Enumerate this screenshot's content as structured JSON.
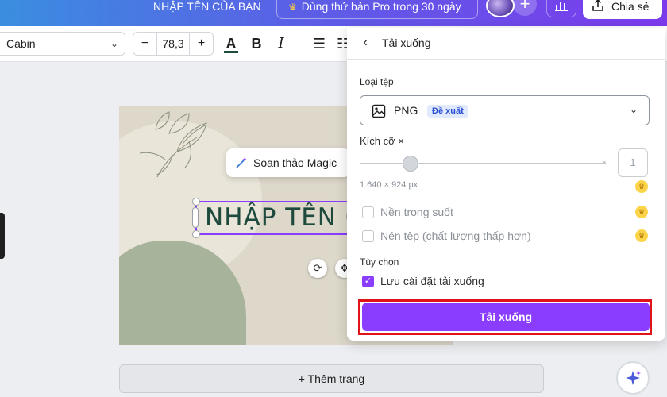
{
  "header": {
    "doc_title": "NHẬP TÊN CỦA BẠN",
    "pro_trial": "Dùng thử bản Pro trong 30 ngày",
    "add_label": "+",
    "share_label": "Chia sẻ"
  },
  "toolbar": {
    "font_family": "Cabin",
    "font_size": "78,3",
    "minus": "−",
    "plus": "+",
    "text_color_glyph": "A",
    "bold_glyph": "B",
    "italic_glyph": "I",
    "align_glyph": "☰",
    "list_glyph": "☷"
  },
  "canvas": {
    "heading": "NHẬP TÊN CỦA BẠN",
    "magic_edit": "Soạn thảo Magic",
    "add_page": "+ Thêm trang",
    "text_color": "#1d4a3c"
  },
  "download_panel": {
    "title": "Tải xuống",
    "file_type_label": "Loại tệp",
    "file_type_value": "PNG",
    "recommended_badge": "Đề xuất",
    "size_label": "Kích cỡ ×",
    "size_value": "1",
    "dimensions": "1.640 × 924 px",
    "transparent_bg": "Nền trong suốt",
    "compress_file": "Nén tệp (chất lượng thấp hơn)",
    "options_label": "Tùy chọn",
    "save_settings": "Lưu cài đặt tải xuống",
    "save_settings_checked": true,
    "download_button": "Tải xuống",
    "accent_color": "#8b3dff",
    "highlight_color": "#e0121a"
  },
  "icons": [
    "crown-icon",
    "avatar",
    "plus-icon",
    "chart-icon",
    "share-icon",
    "chevron-down-icon",
    "back-arrow-icon",
    "image-icon",
    "wand-icon",
    "rotate-icon",
    "move-icon",
    "sparkle-icon"
  ]
}
